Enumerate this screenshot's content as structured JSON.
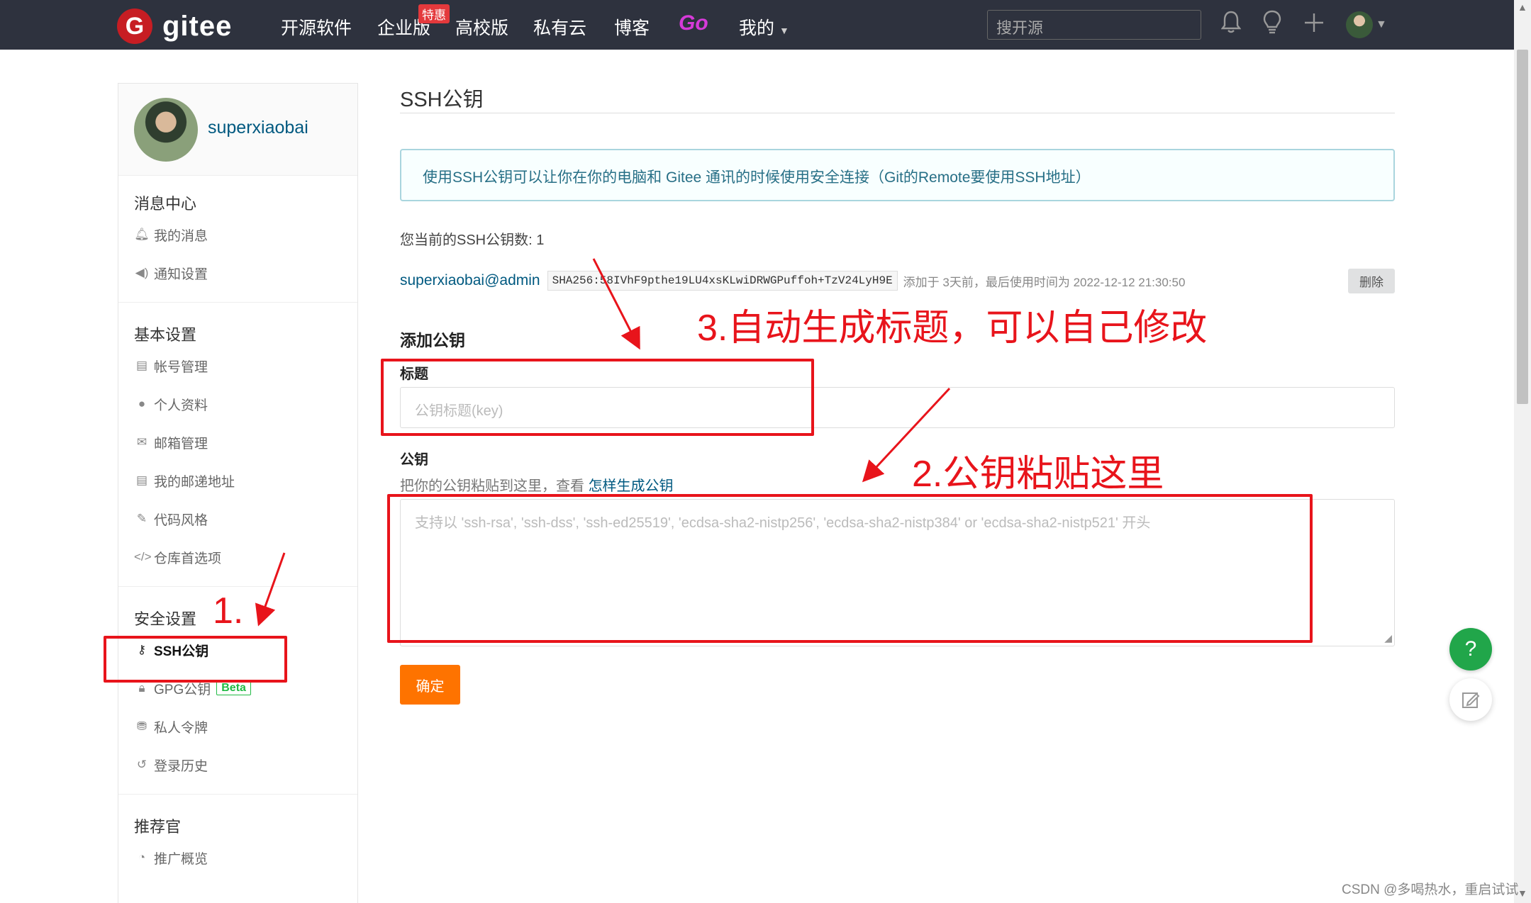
{
  "nav": {
    "logo_mark": "G",
    "logo_text": "gitee",
    "items": [
      "开源软件",
      "企业版",
      "高校版",
      "私有云",
      "博客",
      "Go",
      "我的"
    ],
    "hot_badge": "特惠",
    "search_placeholder": "搜开源",
    "icons": [
      "bell-icon",
      "lightbulb-icon",
      "plus-icon",
      "avatar",
      "chevron-down-icon"
    ]
  },
  "sidebar": {
    "username": "superxiaobai",
    "sections": [
      {
        "title": "消息中心",
        "items": [
          {
            "icon": "bell-icon",
            "label": "我的消息"
          },
          {
            "icon": "speaker-icon",
            "label": "通知设置"
          }
        ]
      },
      {
        "title": "基本设置",
        "items": [
          {
            "icon": "id-card-icon",
            "label": "帐号管理"
          },
          {
            "icon": "user-icon",
            "label": "个人资料"
          },
          {
            "icon": "mail-icon",
            "label": "邮箱管理"
          },
          {
            "icon": "address-card-icon",
            "label": "我的邮递地址"
          },
          {
            "icon": "brush-icon",
            "label": "代码风格"
          },
          {
            "icon": "code-icon",
            "label": "仓库首选项"
          }
        ]
      },
      {
        "title": "安全设置",
        "items": [
          {
            "icon": "key-icon",
            "label": "SSH公钥",
            "active": true
          },
          {
            "icon": "lock-icon",
            "label": "GPG公钥",
            "badge": "Beta"
          },
          {
            "icon": "token-icon",
            "label": "私人令牌"
          },
          {
            "icon": "history-icon",
            "label": "登录历史"
          }
        ]
      },
      {
        "title": "推荐官",
        "items": [
          {
            "icon": "pie-chart-icon",
            "label": "推广概览"
          }
        ]
      }
    ]
  },
  "main": {
    "title": "SSH公钥",
    "info": "使用SSH公钥可以让你在你的电脑和 Gitee 通讯的时候使用安全连接（Git的Remote要使用SSH地址）",
    "key_count": "您当前的SSH公钥数: 1",
    "key": {
      "user": "superxiaobai@admin",
      "fingerprint": "SHA256:58IVhF9pthe19LU4xsKLwiDRWGPuffoh+TzV24LyH9E",
      "meta": "添加于 3天前，最后使用时间为 2022-12-12 21:30:50",
      "delete_label": "删除"
    },
    "add_title": "添加公钥",
    "title_label": "标题",
    "title_placeholder": "公钥标题(key)",
    "key_label": "公钥",
    "key_hint": "把你的公钥粘贴到这里，查看 ",
    "key_hint_link": "怎样生成公钥",
    "key_placeholder": "支持以 'ssh-rsa', 'ssh-dss', 'ssh-ed25519', 'ecdsa-sha2-nistp256', 'ecdsa-sha2-nistp384' or 'ecdsa-sha2-nistp521' 开头",
    "confirm_label": "确定"
  },
  "floating": {
    "help": "?"
  },
  "annotations": {
    "step1": "1.",
    "step2": "2.公钥粘贴这里",
    "step3": "3.自动生成标题，可以自己修改",
    "color": "#e8141b"
  },
  "watermark": "CSDN @多喝热水，重启试试"
}
